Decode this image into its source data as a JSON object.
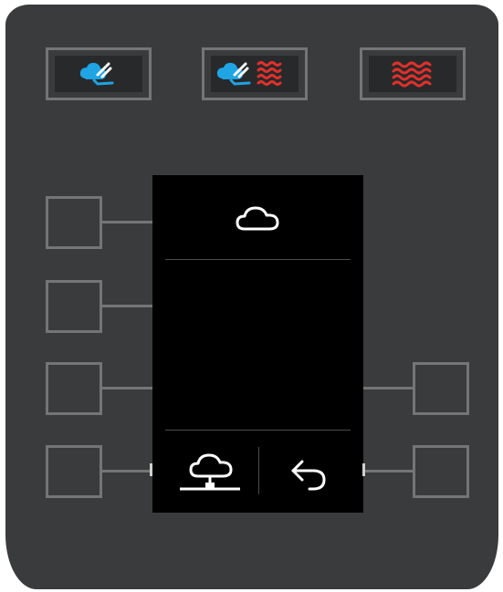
{
  "panel": {
    "mode_buttons": [
      {
        "name": "steam",
        "icon": "steam-icon"
      },
      {
        "name": "combi",
        "icon": "combi-steam-hot-air-icon"
      },
      {
        "name": "hot_air",
        "icon": "hot-air-icon"
      }
    ],
    "colors": {
      "panel": "#393b3c",
      "key_border": "#737576",
      "steam": "#1fa4e4",
      "heat": "#e0302b",
      "display": "#000000",
      "display_icons": "#ffffff"
    }
  },
  "display": {
    "top_icon": "cloud-icon",
    "bottom_left_icon": "cloud-network-icon",
    "bottom_right_icon": "back-arrow-icon"
  }
}
